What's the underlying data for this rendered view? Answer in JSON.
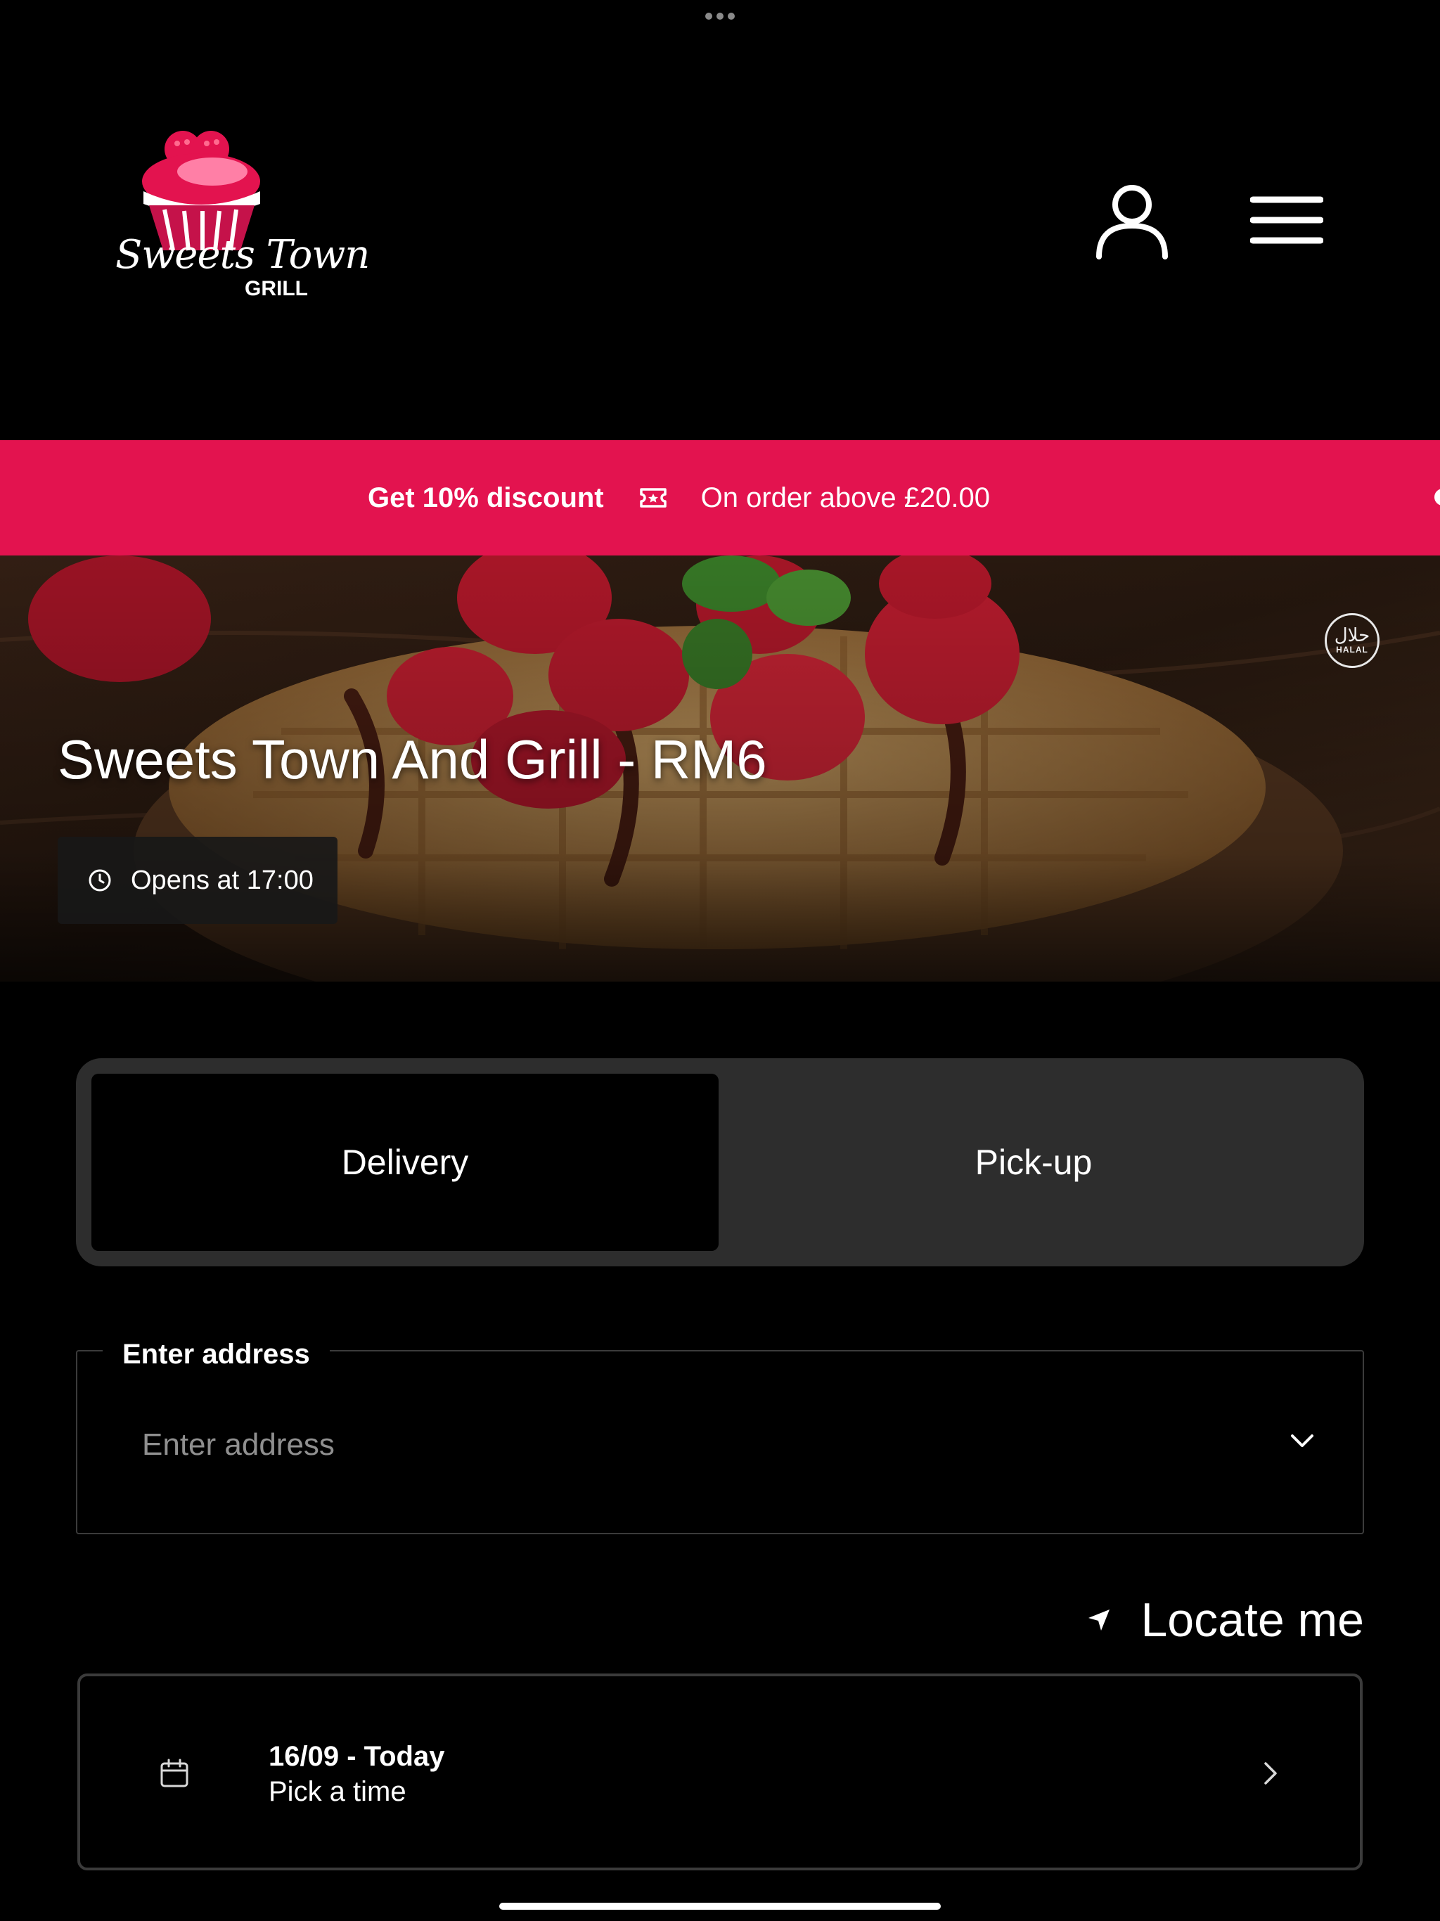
{
  "header": {
    "logo_text": "Sweets Town",
    "logo_sub": "GRILL",
    "user_icon": "user-icon",
    "menu_icon": "hamburger-menu-icon"
  },
  "promo": {
    "title": "Get 10% discount",
    "icon": "ticket-icon",
    "detail": "On order above £20.00"
  },
  "hero": {
    "restaurant_name": "Sweets Town And Grill - RM6",
    "hours_icon": "clock-icon",
    "hours_text": "Opens at 17:00",
    "badge_arabic": "حلال",
    "badge_label": "HALAL"
  },
  "order_mode": {
    "tabs": [
      {
        "label": "Delivery",
        "selected": true
      },
      {
        "label": "Pick-up",
        "selected": false
      }
    ]
  },
  "address": {
    "label": "Enter address",
    "placeholder": "Enter address",
    "value": ""
  },
  "locate": {
    "icon": "location-arrow-icon",
    "label": "Locate me"
  },
  "time": {
    "icon": "calendar-icon",
    "date": "16/09 - Today",
    "prompt": "Pick a time"
  },
  "colors": {
    "accent": "#e3134f",
    "background": "#000000",
    "surface": "#2d2d2d",
    "border": "#3b3b3b"
  }
}
